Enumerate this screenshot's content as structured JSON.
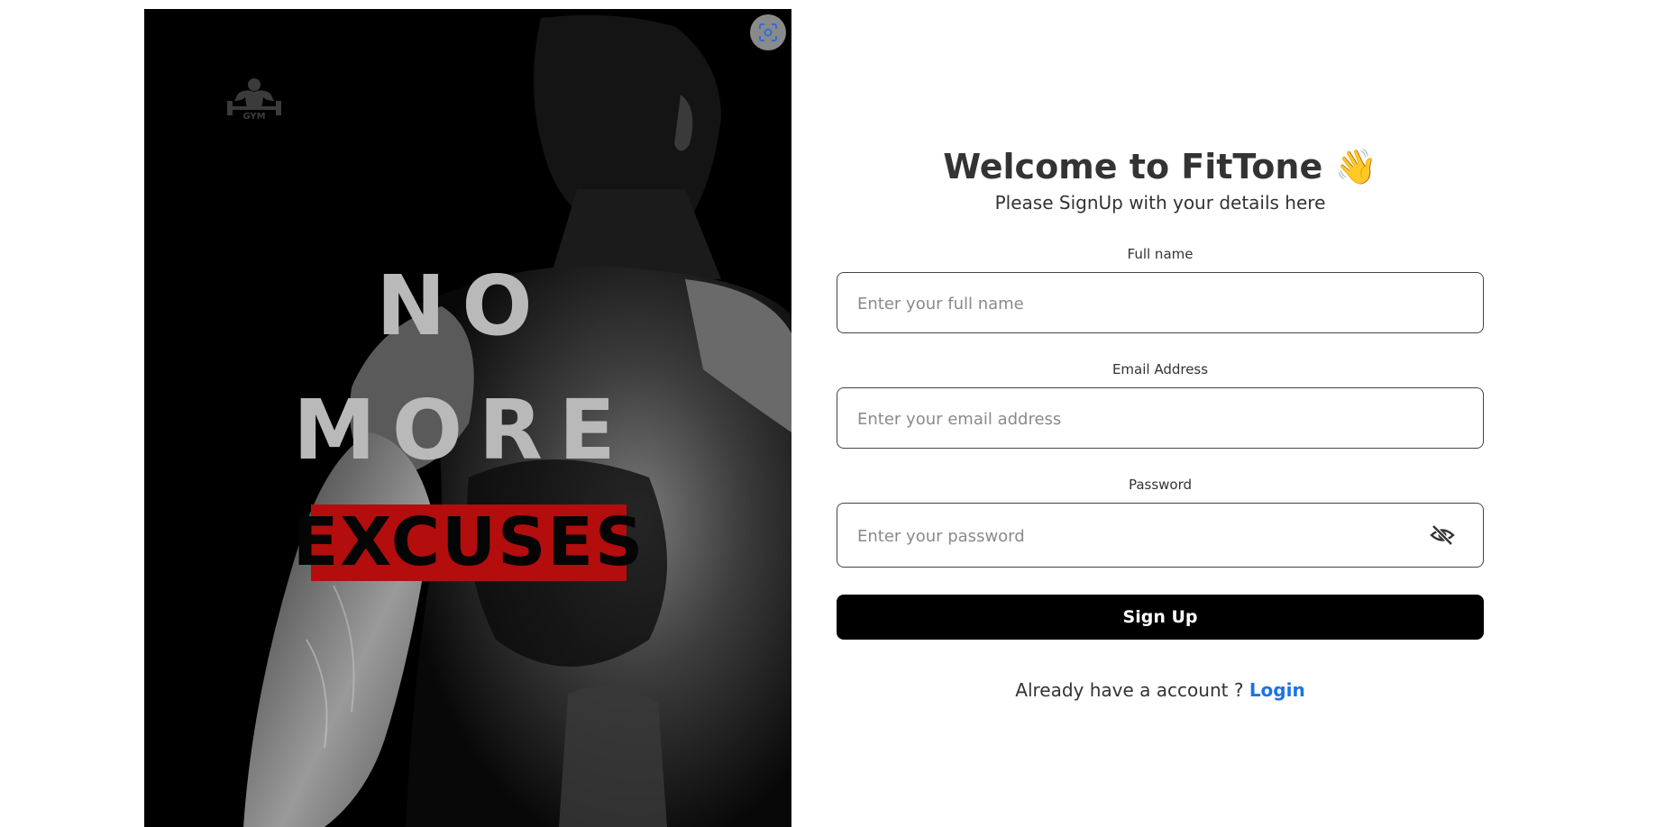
{
  "hero": {
    "logo_text": "GYM",
    "line1": "NO",
    "line2": "MORE",
    "line3": "EXCUSES",
    "accent_color": "#b30d0d",
    "scan_icon": "scan-focus-icon"
  },
  "form": {
    "title": "Welcome to FitTone",
    "title_emoji": "👋",
    "subtitle": "Please SignUp with your details here",
    "fields": {
      "full_name": {
        "label": "Full name",
        "placeholder": "Enter your full name"
      },
      "email": {
        "label": "Email Address",
        "placeholder": "Enter your email address"
      },
      "password": {
        "label": "Password",
        "placeholder": "Enter your password",
        "toggle_icon": "eye-off-icon"
      }
    },
    "submit_label": "Sign Up",
    "login_prompt": "Already have a account ?",
    "login_link": "Login",
    "link_color": "#1a73e8"
  }
}
